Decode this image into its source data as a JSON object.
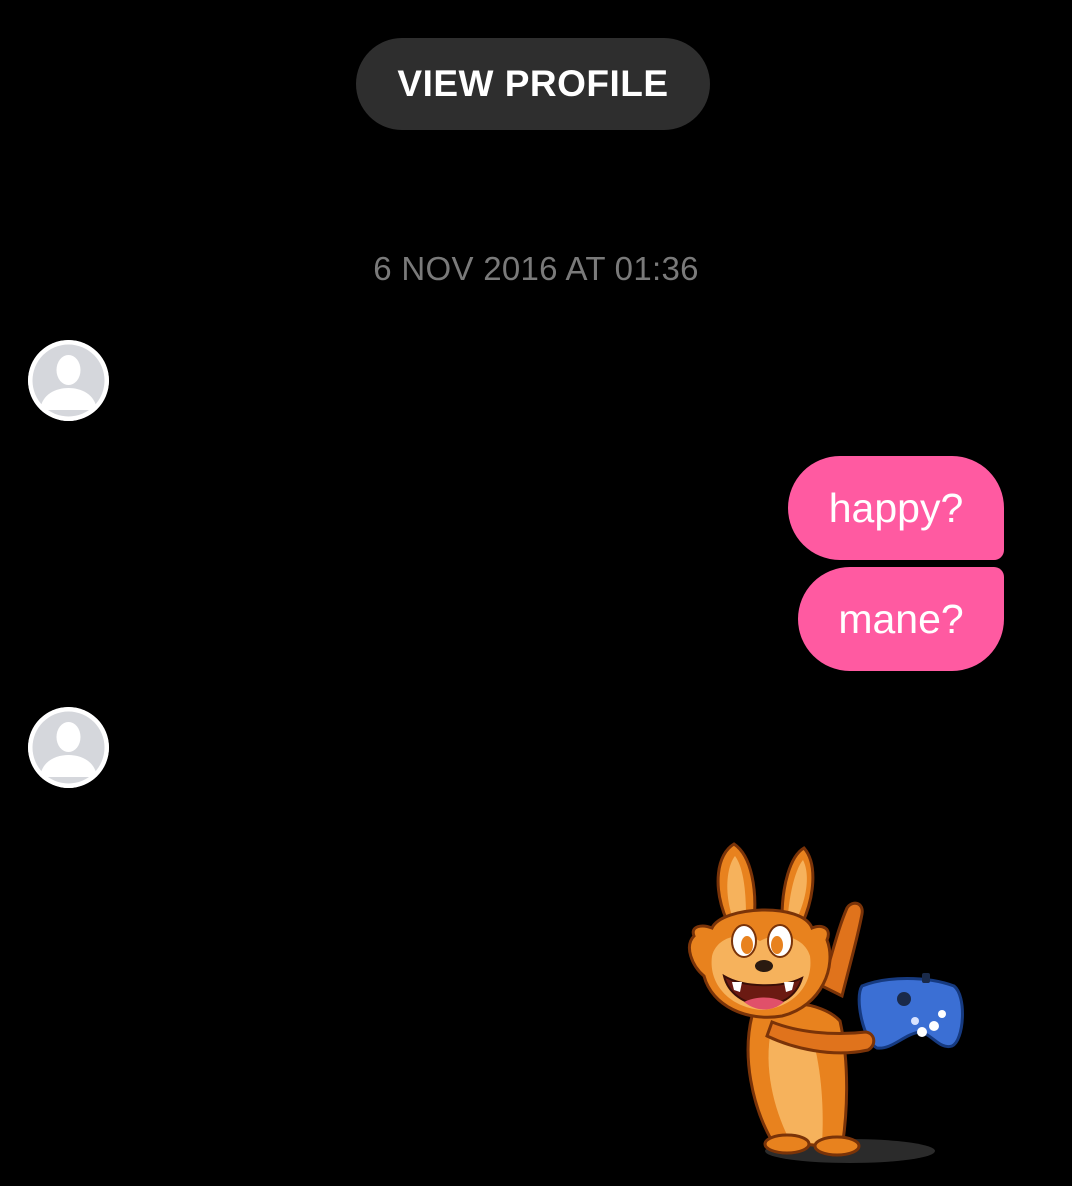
{
  "header": {
    "view_profile_label": "VIEW PROFILE"
  },
  "thread": {
    "timestamp": "6 NOV 2016 AT 01:36",
    "messages": [
      {
        "sender": "me",
        "text": "happy?"
      },
      {
        "sender": "me",
        "text": "mane?"
      }
    ],
    "sticker": {
      "description_icon": "fox-with-game-controller-sticker"
    }
  },
  "colors": {
    "background": "#000000",
    "sent_bubble": "#ff5aa1",
    "pill_button": "#2e2e2e",
    "timestamp_text": "#7a7a7a",
    "avatar_placeholder": "#d5d7dc"
  }
}
